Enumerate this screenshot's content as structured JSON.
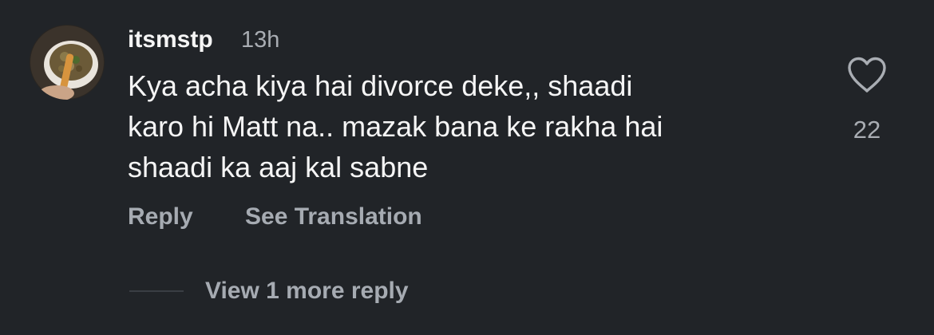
{
  "comment": {
    "avatar": "user-avatar-photo",
    "username": "itsmstp",
    "timestamp": "13h",
    "text_lines": [
      "Kya acha kiya hai divorce deke,, shaadi",
      "karo hi Matt na.. mazak bana ke rakha hai",
      "shaadi ka aaj kal sabne"
    ],
    "like_icon": "heart-outline-icon",
    "like_count": "22",
    "actions": {
      "reply_label": "Reply",
      "translate_label": "See Translation"
    },
    "replies": {
      "view_more_label": "View 1 more reply"
    }
  },
  "colors": {
    "background": "#212428",
    "primary_text": "#f5f5f5",
    "secondary_text": "#a6abb2"
  }
}
